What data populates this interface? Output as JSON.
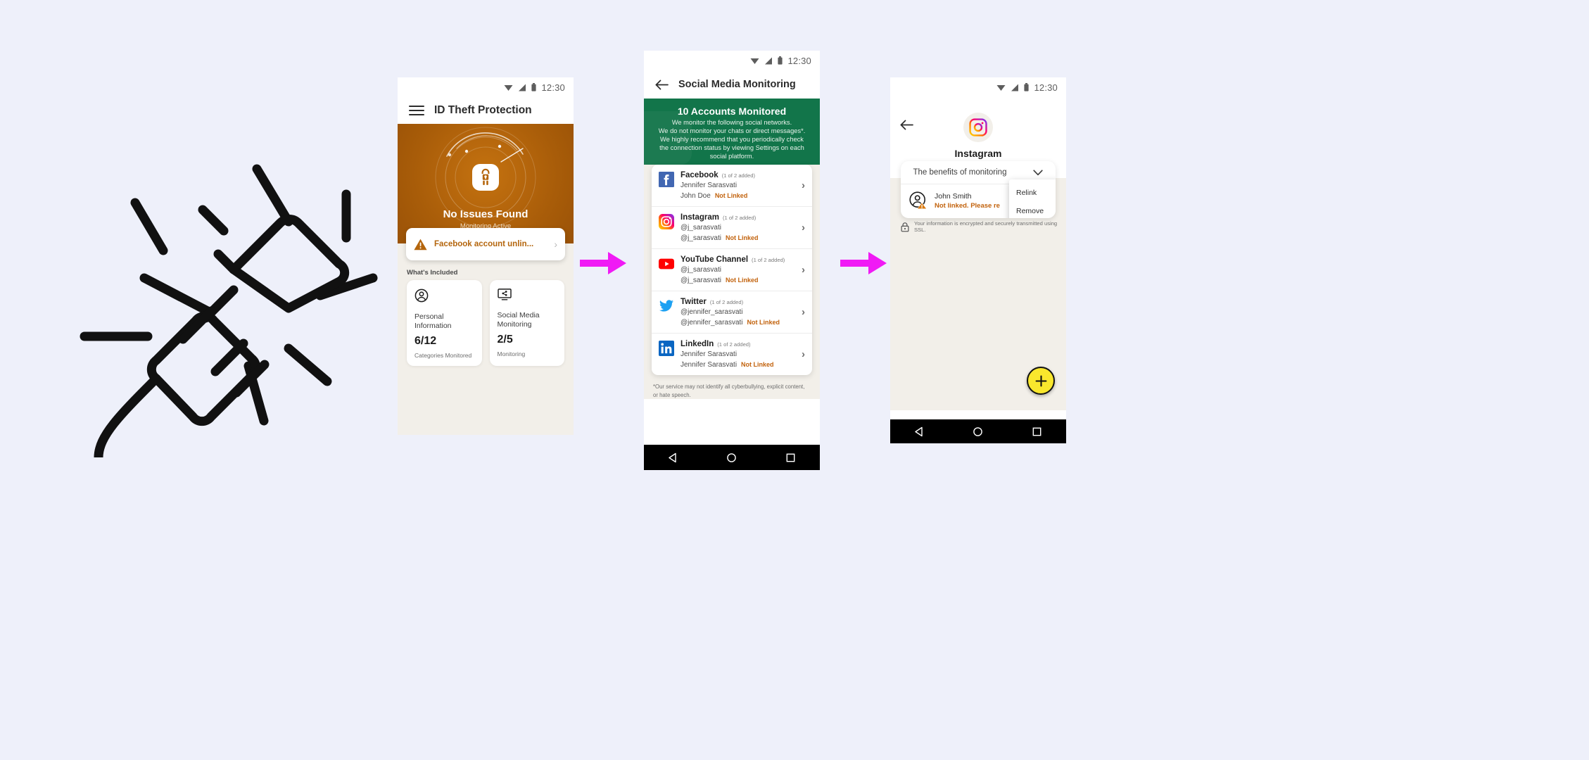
{
  "canvas": {
    "background": "#eef0fa",
    "arrow_color": "#f01af5"
  },
  "illustration": {
    "name": "unplugged-plug-disconnected"
  },
  "status_bar": {
    "clock": "12:30"
  },
  "phone1": {
    "appbar": {
      "title": "ID Theft Protection",
      "menu_icon": "hamburger-icon"
    },
    "hero": {
      "headline": "No Issues Found",
      "subtitle": "Monitoring Active",
      "background": "#b4650c"
    },
    "alert": {
      "text": "Facebook account unlin...",
      "icon": "warning-triangle-icon",
      "chevron": "›"
    },
    "section_label": "What's Included",
    "cards": [
      {
        "icon": "person-circle-icon",
        "name": "Personal Information",
        "value": "6/12",
        "desc": "Categories Monitored"
      },
      {
        "icon": "screen-share-icon",
        "name": "Social Media Monitoring",
        "value": "2/5",
        "desc": "Monitoring"
      }
    ]
  },
  "phone2": {
    "appbar": {
      "title": "Social Media Monitoring",
      "back_icon": "arrow-left-icon"
    },
    "header": {
      "title": "10 Accounts Monitored",
      "body": "We monitor the following social networks.\nWe do not monitor your chats or direct messages*.\nWe highly recommend that you periodically check\nthe connection status by viewing Settings on each\nsocial platform.",
      "background": "#12754a"
    },
    "accounts": [
      {
        "platform": "Facebook",
        "logo": "facebook-icon",
        "added": "(1 of 2 added)",
        "account": "Jennifer Sarasvati",
        "second": "John Doe",
        "status": "Not Linked"
      },
      {
        "platform": "Instagram",
        "logo": "instagram-icon",
        "added": "(1 of 2 added)",
        "account": "@j_sarasvati",
        "second": "@j_sarasvati",
        "status": "Not Linked"
      },
      {
        "platform": "YouTube Channel",
        "logo": "youtube-icon",
        "added": "(1 of 2 added)",
        "account": "@j_sarasvati",
        "second": "@j_sarasvati",
        "status": "Not Linked"
      },
      {
        "platform": "Twitter",
        "logo": "twitter-icon",
        "added": "(1 of 2 added)",
        "account": "@jennifer_sarasvati",
        "second": "@jennifer_sarasvati",
        "status": "Not Linked"
      },
      {
        "platform": "LinkedIn",
        "logo": "linkedin-icon",
        "added": "(1 of 2 added)",
        "account": "Jennifer Sarasvati",
        "second": "Jennifer Sarasvati",
        "status": "Not Linked"
      }
    ],
    "footer": "*Our service may not identify all cyberbullying, explicit content, or hate speech."
  },
  "phone3": {
    "back_icon": "arrow-left-icon",
    "logo": "instagram-icon",
    "title": "Instagram",
    "dropdown": {
      "label": "The benefits of monitoring",
      "chevron": "chevron-down-icon"
    },
    "user": {
      "avatar": "person-warning-avatar-icon",
      "name": "John Smith",
      "status": "Not linked. Please re"
    },
    "menu": {
      "items": [
        "Relink",
        "Remove"
      ]
    },
    "ssl": {
      "icon": "lock-icon",
      "text": "Your information is encrypted and securely transmitted using SSL."
    },
    "fab": {
      "icon": "plus-icon",
      "color": "#f9e72d"
    }
  },
  "nav_bar": {
    "back": "triangle-back-icon",
    "home": "circle-home-icon",
    "recents": "square-recents-icon"
  }
}
